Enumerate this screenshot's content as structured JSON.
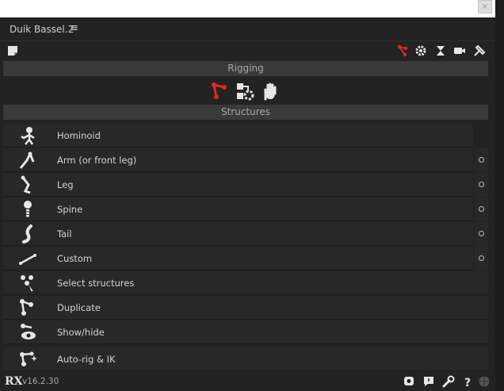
{
  "window": {
    "close_glyph": "×"
  },
  "header": {
    "title": "Duik Bassel.2",
    "menu_glyph": "≡"
  },
  "sections": {
    "rigging": "Rigging",
    "structures": "Structures"
  },
  "structures": [
    {
      "label": "Hominoid",
      "icon": "hominoid-icon",
      "has_options": false
    },
    {
      "label": "Arm (or front leg)",
      "icon": "arm-icon",
      "has_options": true
    },
    {
      "label": "Leg",
      "icon": "leg-icon",
      "has_options": true
    },
    {
      "label": "Spine",
      "icon": "spine-icon",
      "has_options": true
    },
    {
      "label": "Tail",
      "icon": "tail-icon",
      "has_options": true
    },
    {
      "label": "Custom",
      "icon": "custom-bone-icon",
      "has_options": true
    }
  ],
  "actions": [
    {
      "label": "Select structures",
      "icon": "select-structures-icon"
    },
    {
      "label": "Duplicate",
      "icon": "duplicate-icon"
    },
    {
      "label": "Show/hide",
      "icon": "show-hide-icon"
    },
    {
      "label": "Auto-rig & IK",
      "icon": "autorig-icon"
    }
  ],
  "footer": {
    "logo": "RX",
    "version": "v16.2.30"
  },
  "colors": {
    "accent": "#e0282a",
    "panel": "#232323",
    "row": "#282828",
    "bar": "#3a3a3a"
  }
}
